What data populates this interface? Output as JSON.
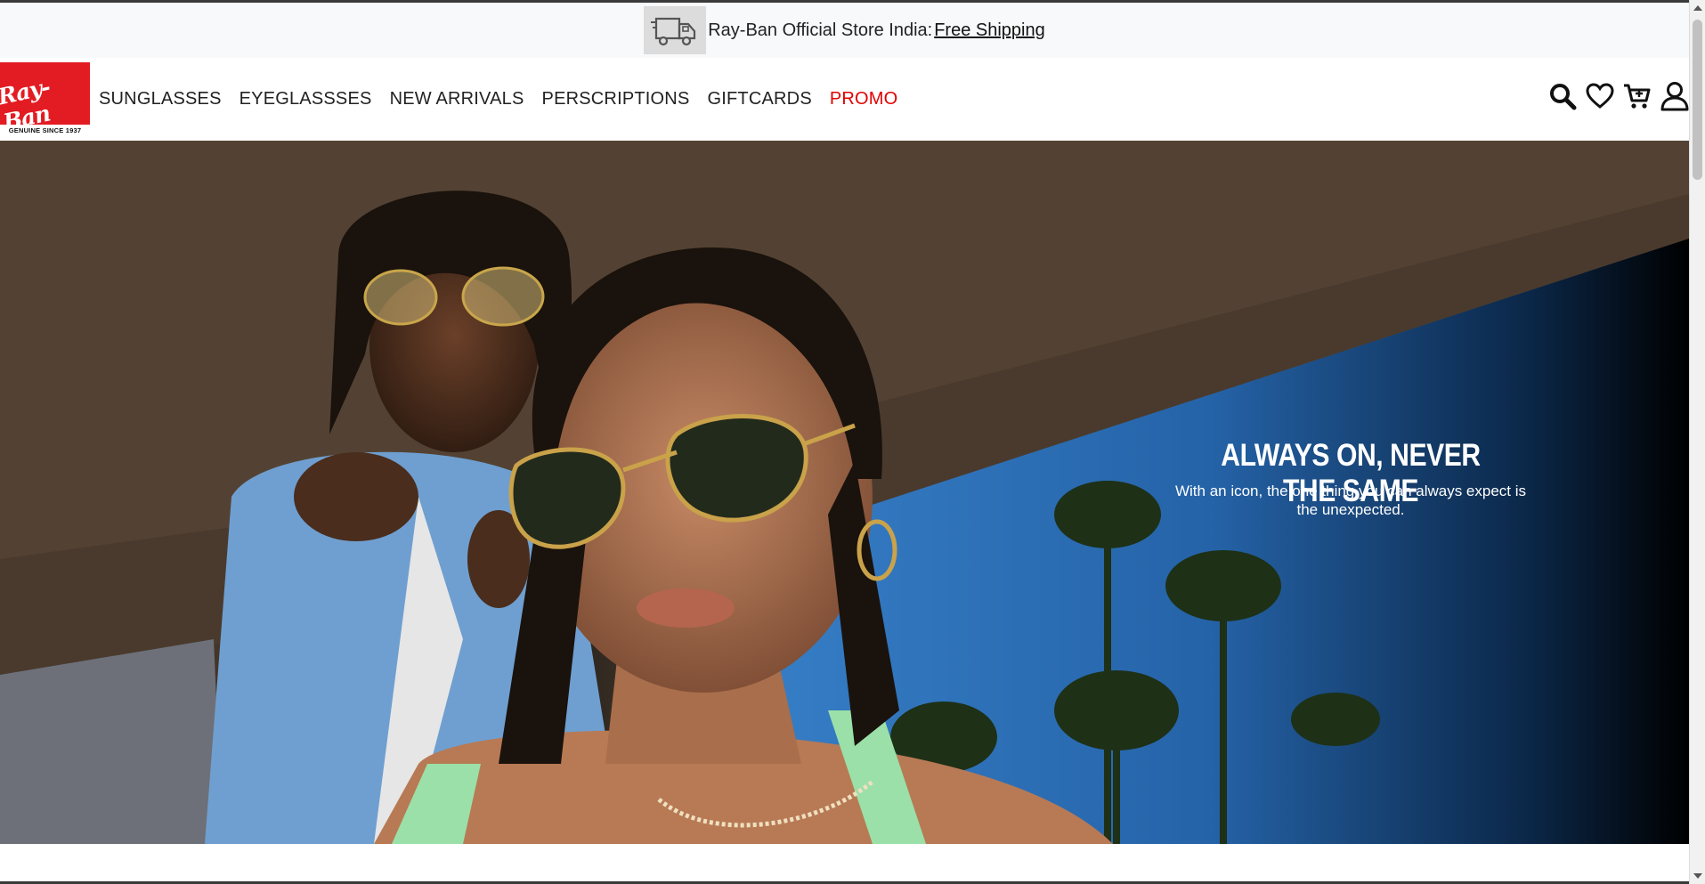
{
  "announcement": {
    "text": "Ray-Ban Official Store India:",
    "link": "Free Shipping",
    "icon": "truck-icon"
  },
  "logo": {
    "script": "Ray-Ban",
    "tagline": "GENUINE SINCE 1937"
  },
  "nav": {
    "items": [
      {
        "label": "SUNGLASSES"
      },
      {
        "label": "EYEGLASSSES"
      },
      {
        "label": "NEW ARRIVALS"
      },
      {
        "label": "PERSCRIPTIONS"
      },
      {
        "label": "GIFTCARDS"
      },
      {
        "label": "PROMO"
      }
    ],
    "icons": [
      "search-icon",
      "heart-icon",
      "cart-icon",
      "user-icon"
    ]
  },
  "hero": {
    "headline": "ALWAYS ON, NEVER THE SAME",
    "subline": "With an icon, the one thing you can always expect is the unexpected."
  },
  "colors": {
    "brand_red": "#e31c23",
    "promo_red": "#e10000",
    "announce_bg": "#f8f9fa"
  }
}
